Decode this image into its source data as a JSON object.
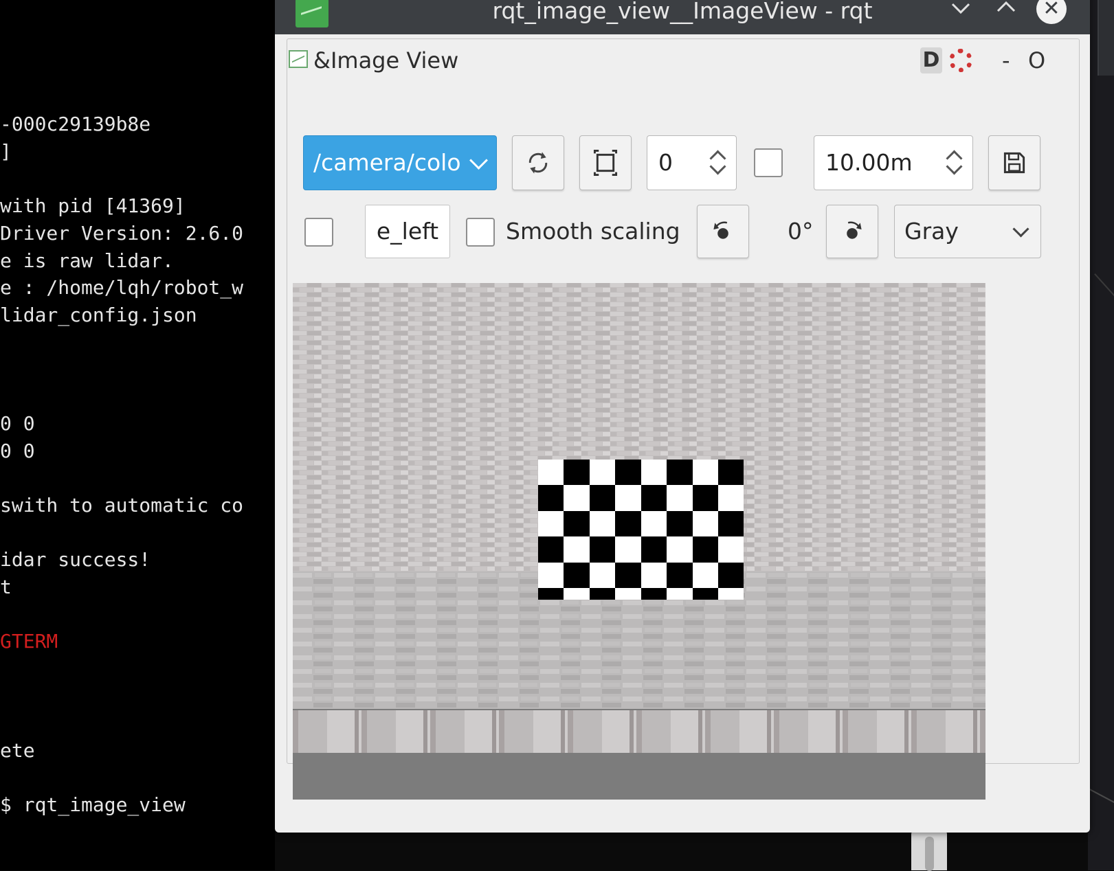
{
  "terminal": {
    "lines": [
      {
        "text": "-000c29139b8e",
        "color": "#e6e6e6"
      },
      {
        "text": "]",
        "color": "#e6e6e6"
      },
      {
        "text": "with pid [41369]",
        "color": "#e6e6e6"
      },
      {
        "text": "Driver Version: 2.6.0",
        "color": "#e6e6e6"
      },
      {
        "text": "e is raw lidar.",
        "color": "#e6e6e6"
      },
      {
        "text": "e : /home/lqh/robot_w",
        "color": "#e6e6e6"
      },
      {
        "text": "lidar_config.json",
        "color": "#e6e6e6"
      },
      {
        "text": "0 0",
        "color": "#e6e6e6"
      },
      {
        "text": "0 0",
        "color": "#e6e6e6"
      },
      {
        "text": "swith to automatic co",
        "color": "#e6e6e6"
      },
      {
        "text": "idar success!",
        "color": "#e6e6e6"
      },
      {
        "text": "t",
        "color": "#e6e6e6"
      },
      {
        "text": "GTERM",
        "color": "#d21e1e"
      },
      {
        "text": "ete",
        "color": "#e6e6e6"
      },
      {
        "text": "$ rqt_image_view",
        "color": "#e6e6e6"
      }
    ]
  },
  "window": {
    "title": "rqt_image_view__ImageView - rqt",
    "minimize_icon": "chevron-down-icon",
    "maximize_icon": "chevron-up-icon",
    "close_icon": "close-icon",
    "close_glyph": "✕",
    "min_glyph": "⌄",
    "max_glyph": "⌃"
  },
  "dock": {
    "title": "&Image View",
    "d_label": "D",
    "minus_label": "-",
    "float_label": "O"
  },
  "toolbar": {
    "topic": "/camera/colo",
    "refresh_icon": "refresh-icon",
    "fit_icon": "fit-to-window-icon",
    "zoom_value": "0",
    "max_range_value": "10.00m",
    "save_icon": "save-icon",
    "frame_field": "e_left",
    "smooth_label": "Smooth scaling",
    "rotate_left_icon": "rotate-left-icon",
    "rotation_label": "0°",
    "rotate_right_icon": "rotate-right-icon",
    "color_scheme": "Gray"
  },
  "colors": {
    "accent": "#3ba3e3",
    "titlebar": "#3c3f43",
    "terminal_bg": "#000000"
  }
}
